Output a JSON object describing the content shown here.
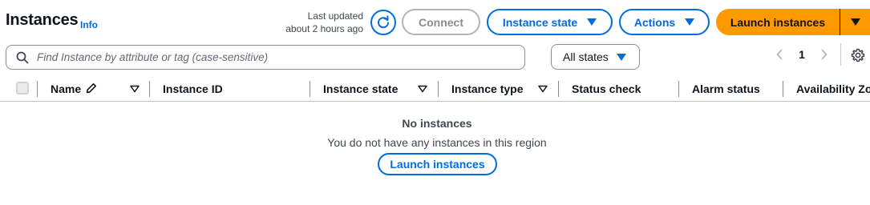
{
  "header": {
    "title": "Instances",
    "info_label": "Info",
    "last_updated_line1": "Last updated",
    "last_updated_line2": "about 2 hours ago",
    "connect_label": "Connect",
    "instance_state_label": "Instance state",
    "actions_label": "Actions",
    "launch_label": "Launch instances"
  },
  "filter": {
    "search_placeholder": "Find Instance by attribute or tag (case-sensitive)",
    "state_filter_value": "All states",
    "page": "1"
  },
  "table": {
    "columns": [
      "Name",
      "Instance ID",
      "Instance state",
      "Instance type",
      "Status check",
      "Alarm status",
      "Availability Zone"
    ]
  },
  "empty_state": {
    "title": "No instances",
    "description": "You do not have any instances in this region",
    "button_label": "Launch instances"
  },
  "icons": {
    "refresh": "refresh-icon",
    "search": "search-icon",
    "chevron_left": "chevron-left-icon",
    "chevron_right": "chevron-right-icon",
    "settings": "gear-icon",
    "edit": "pencil-icon",
    "sort": "sort-down-icon",
    "dropdown": "caret-down-icon"
  },
  "colors": {
    "accent": "#006ce0",
    "primary_button": "#ff9900",
    "text": "#0f141a",
    "muted_text": "#424650"
  }
}
